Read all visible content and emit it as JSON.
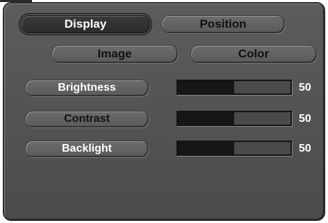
{
  "tabs": [
    {
      "label": "Display",
      "active": true
    },
    {
      "label": "Position",
      "active": false
    }
  ],
  "subtabs": [
    {
      "label": "Image"
    },
    {
      "label": "Color"
    }
  ],
  "settings": [
    {
      "label": "Brightness",
      "value": "50",
      "level_percent": 50
    },
    {
      "label": "Contrast",
      "value": "50",
      "level_percent": 50
    },
    {
      "label": "Backlight",
      "value": "50",
      "level_percent": 50
    }
  ],
  "colors": {
    "panel": "#555555",
    "active_tab": "#333333",
    "bar_fill": "#161616",
    "text_light": "#ffffff",
    "text_dark": "#111111"
  }
}
